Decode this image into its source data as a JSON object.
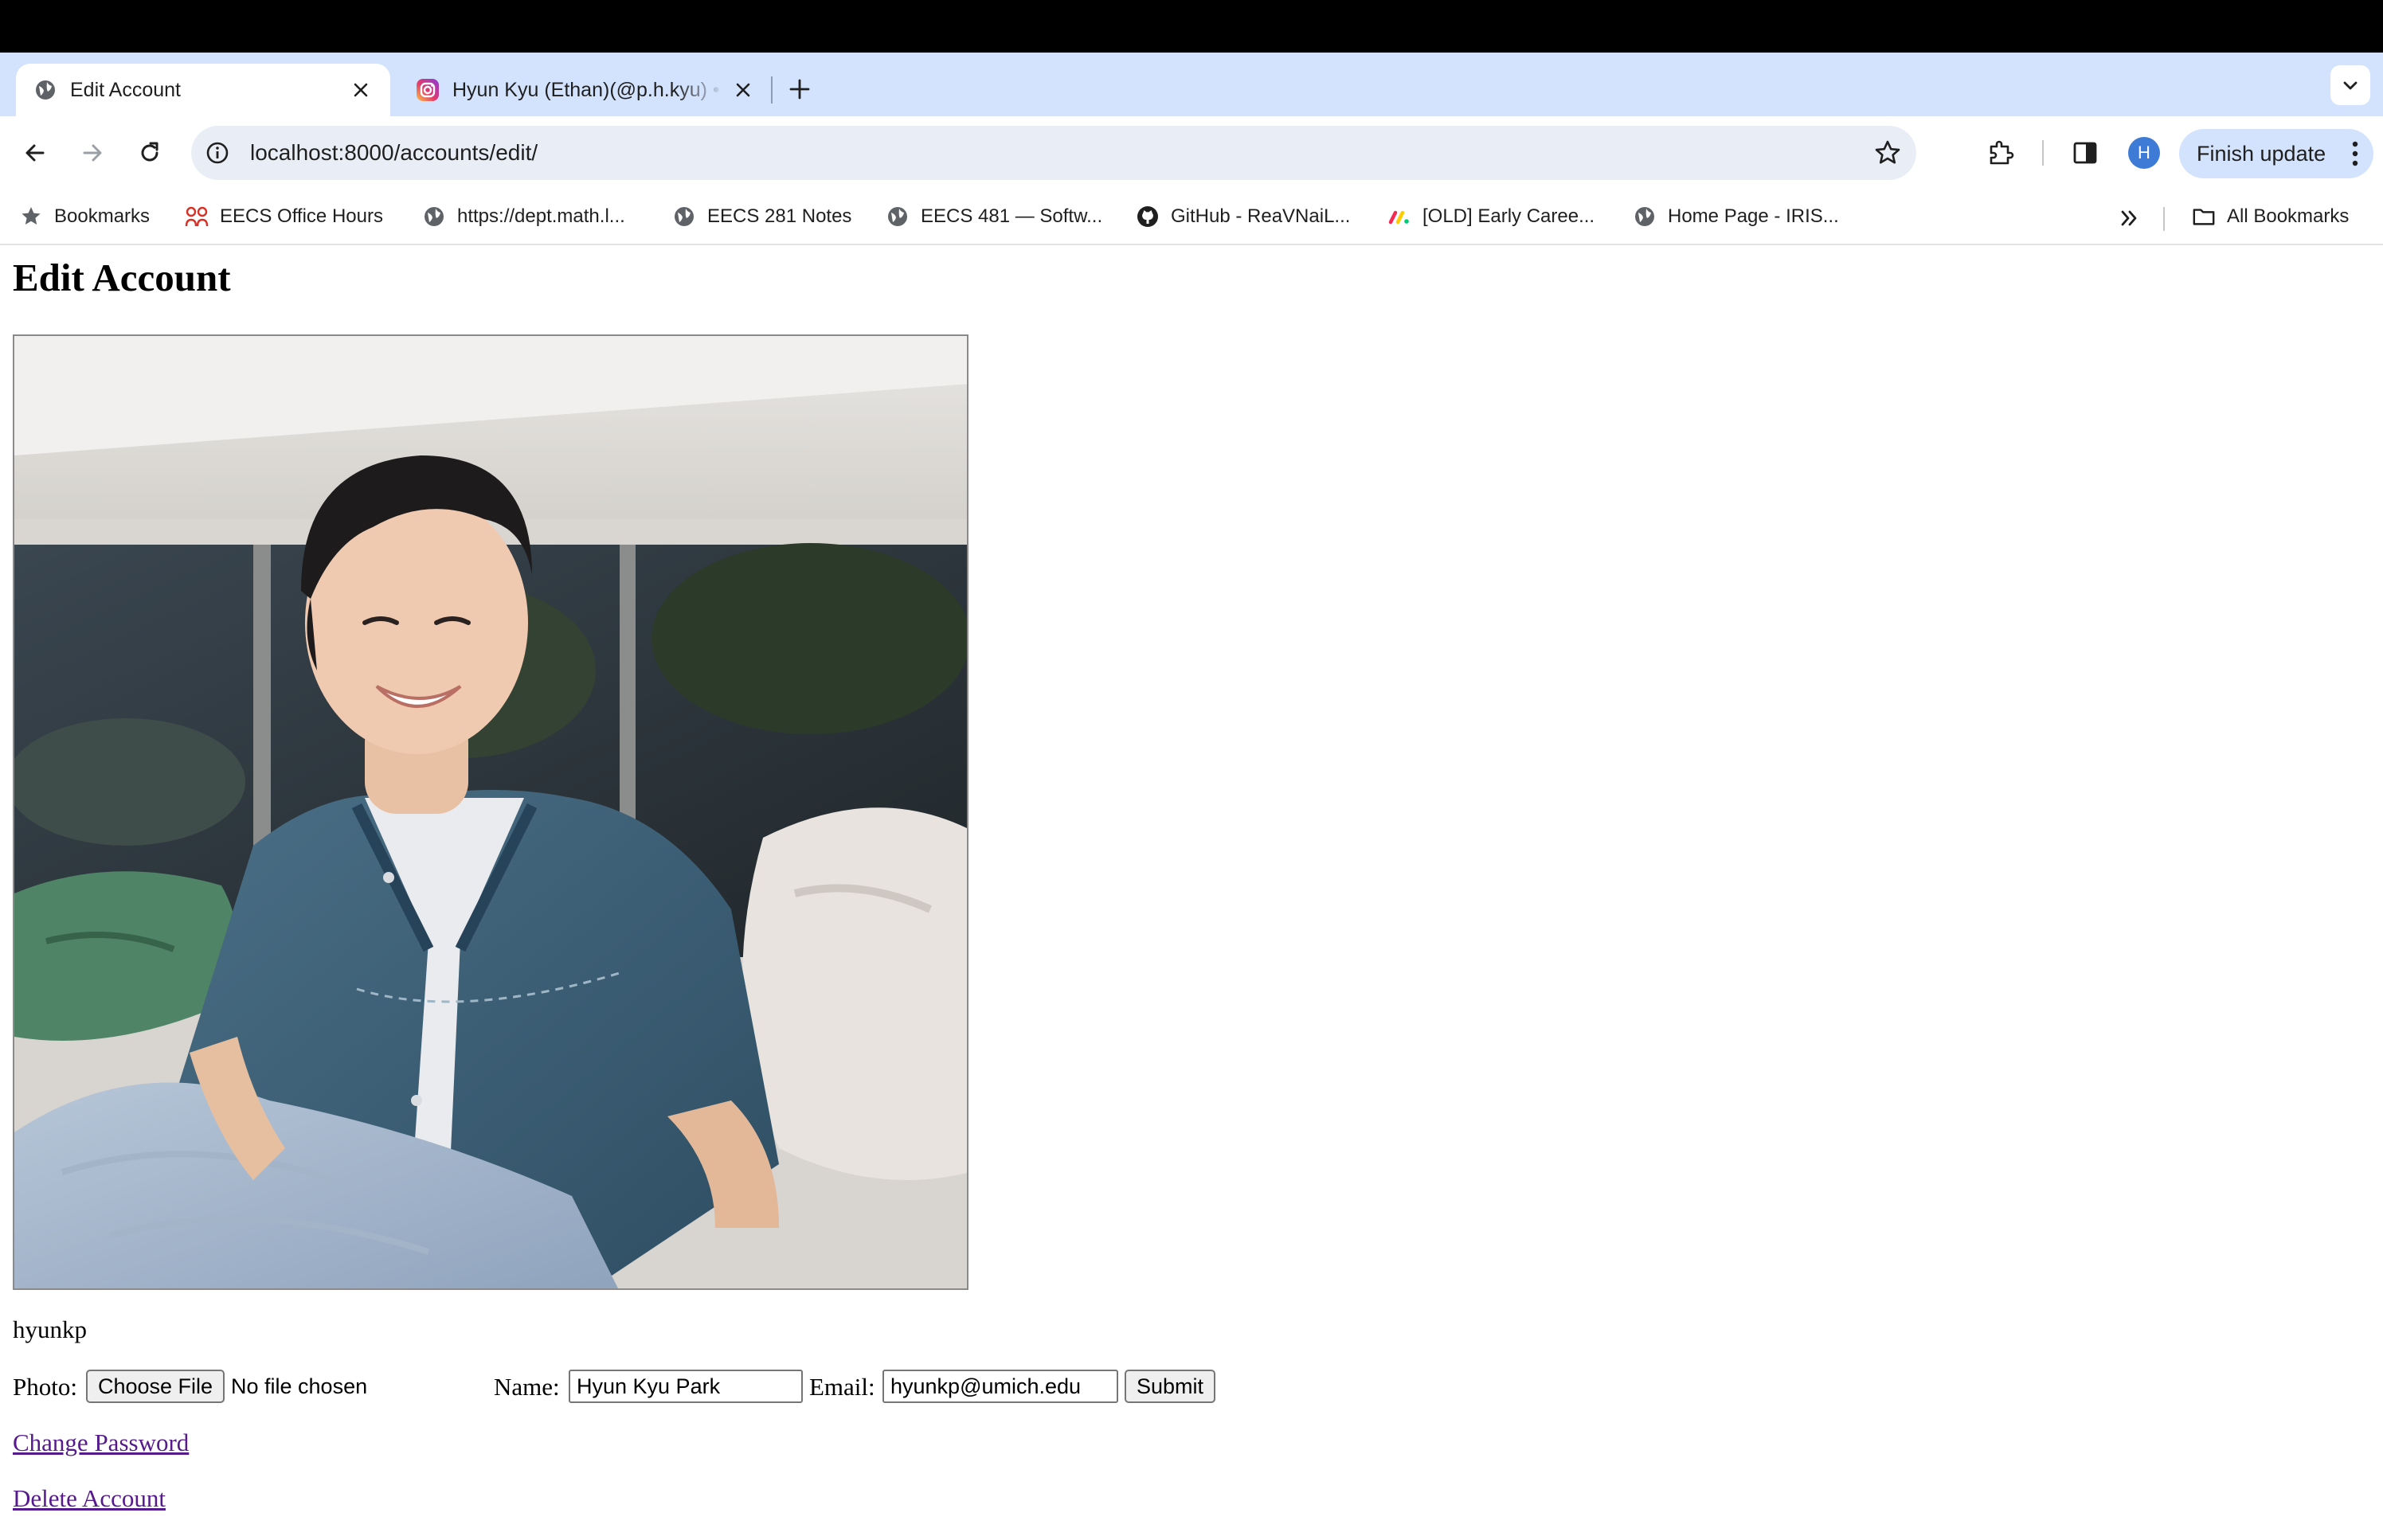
{
  "browser": {
    "tabs": [
      {
        "title": "Edit Account",
        "favicon": "globe-icon",
        "active": true
      },
      {
        "title": "Hyun Kyu (Ethan)(@p.h.kyu) • Instagram",
        "favicon": "instagram-icon",
        "active": false
      }
    ],
    "url": "localhost:8000/accounts/edit/",
    "profile_initial": "H",
    "finish_update_label": "Finish update",
    "bookmarks": [
      {
        "label": "Bookmarks",
        "icon": "star-icon"
      },
      {
        "label": "EECS Office Hours",
        "icon": "office-hours-icon"
      },
      {
        "label": "https://dept.math.l...",
        "icon": "globe-icon"
      },
      {
        "label": "EECS 281 Notes",
        "icon": "globe-icon"
      },
      {
        "label": "EECS 481 — Softw...",
        "icon": "globe-icon"
      },
      {
        "label": "GitHub - ReaVNaiL...",
        "icon": "github-icon"
      },
      {
        "label": "[OLD] Early Caree...",
        "icon": "monday-icon"
      },
      {
        "label": "Home Page - IRIS...",
        "icon": "globe-icon"
      }
    ],
    "all_bookmarks_label": "All Bookmarks"
  },
  "page": {
    "title": "Edit Account",
    "username": "hyunkp",
    "form": {
      "photo_label": "Photo:",
      "choose_file_label": "Choose File",
      "no_file_text": "No file chosen",
      "name_label": "Name:",
      "name_value": "Hyun Kyu Park",
      "email_label": "Email:",
      "email_value": "hyunkp@umich.edu",
      "submit_label": "Submit"
    },
    "links": {
      "change_password": "Change Password",
      "delete_account": "Delete Account"
    }
  },
  "colors": {
    "tabstrip_bg": "#d3e3fd",
    "omnibox_bg": "#e9eef6",
    "visited_link": "#551a8b",
    "avatar_bg": "#3d7bd6"
  }
}
